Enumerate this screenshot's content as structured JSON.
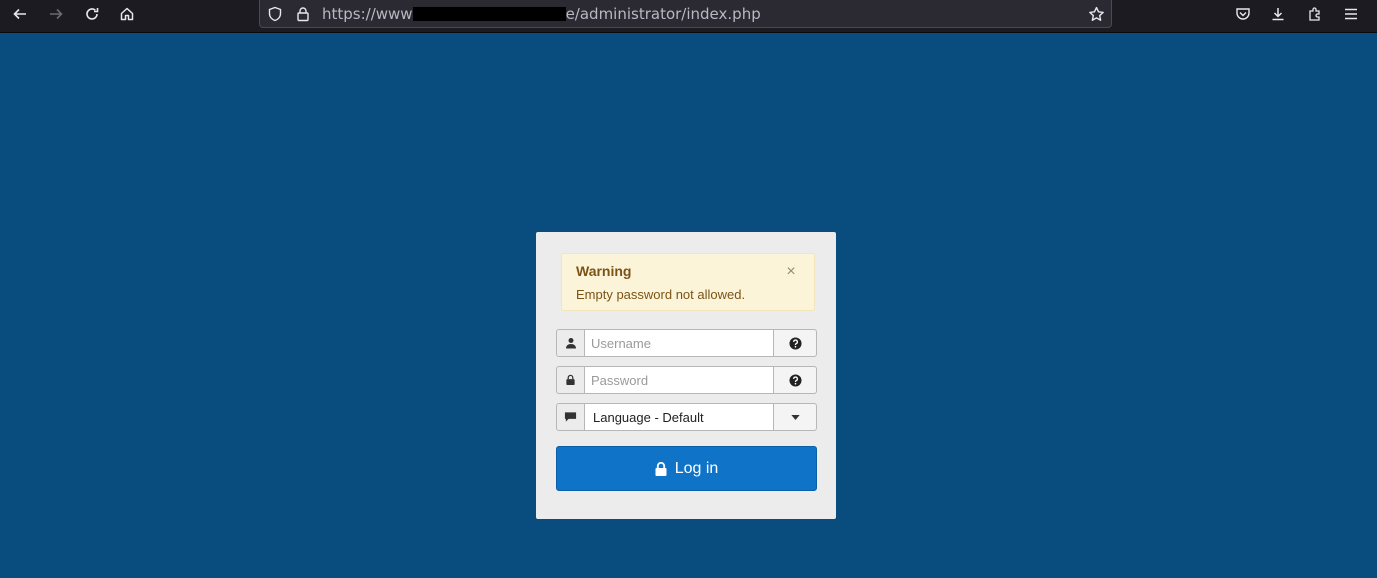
{
  "browser": {
    "url_prefix": "https://www",
    "url_suffix": "e/administrator/index.php"
  },
  "alert": {
    "title": "Warning",
    "message": "Empty password not allowed.",
    "close_glyph": "×"
  },
  "form": {
    "username_placeholder": "Username",
    "password_placeholder": "Password",
    "language_value": "Language - Default",
    "login_label": "Log in"
  },
  "icons": {
    "back": "arrow-left-icon",
    "forward": "arrow-right-icon",
    "reload": "reload-icon",
    "home": "home-icon",
    "shield": "shield-icon",
    "lock": "lock-icon",
    "bookmark": "star-icon",
    "pocket": "pocket-icon",
    "downloads": "download-icon",
    "extensions": "puzzle-icon",
    "menu": "hamburger-icon",
    "user": "user-icon",
    "password": "lock-icon",
    "help": "question-circle-icon",
    "language": "comment-icon",
    "caret": "caret-down-icon"
  },
  "colors": {
    "page_background": "#084d7e",
    "card_background": "#ececec",
    "alert_background": "#fcf4d9",
    "alert_text": "#7a5416",
    "button_primary": "#0f74c8"
  }
}
